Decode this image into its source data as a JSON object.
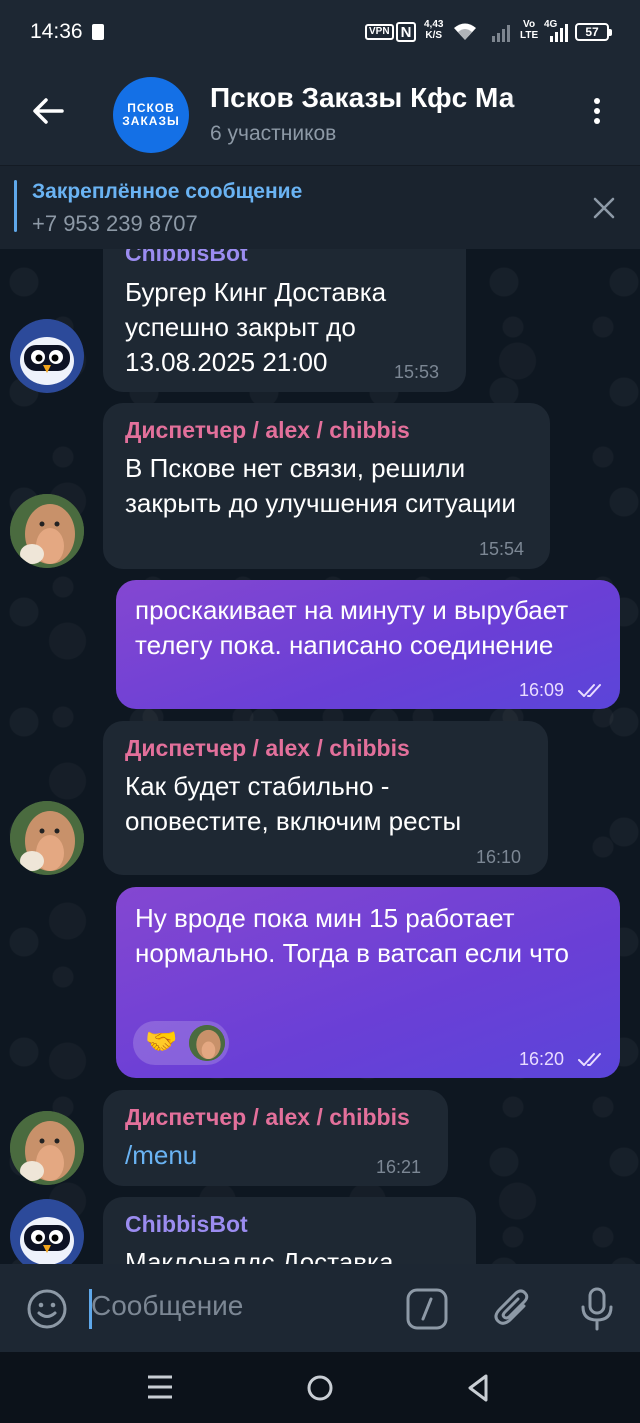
{
  "status": {
    "time": "14:36",
    "vpn": "VPN",
    "nfc": "N",
    "speed_value": "4,43",
    "speed_unit": "K/S",
    "volte_top": "Vo",
    "volte_bottom": "LTE",
    "network": "4G",
    "battery": "57"
  },
  "header": {
    "avatar_line1": "ПСКОВ",
    "avatar_line2": "ЗАКАЗЫ",
    "title": "Псков Заказы Кфс Ма",
    "subtitle": "6 участников"
  },
  "pinned": {
    "label": "Закреплённое сообщение",
    "text": "+7 953 239 8707"
  },
  "messages": [
    {
      "sender": "ChibbisBot",
      "text": "Бургер Кинг Доставка успешно закрыт до 13.08.2025 21:00",
      "time": "15:53"
    },
    {
      "sender": "Диспетчер / alex / chibbis",
      "text": "В Пскове нет связи, решили закрыть до улучшения ситуации",
      "time": "15:54"
    },
    {
      "text": "проскакивает на минуту и вырубает телегу пока. написано соединение",
      "time": "16:09"
    },
    {
      "sender": "Диспетчер / alex / chibbis",
      "text": "Как будет стабильно - оповестите, включим ресты",
      "time": "16:10"
    },
    {
      "text": "Ну вроде пока мин 15 работает нормально. Тогда в ватсап если что",
      "time": "16:20",
      "reaction": "🤝"
    },
    {
      "sender": "Диспетчер / alex / chibbis",
      "text": "/menu",
      "time": "16:21"
    },
    {
      "sender": "ChibbisBot",
      "text": "Макдоналдс Доставка"
    }
  ],
  "input": {
    "placeholder": "Сообщение"
  },
  "colors": {
    "outgoing": "#7a44d4",
    "incoming": "#1e2833",
    "accent": "#6ab3f3",
    "sender": "#e3709b"
  },
  "icons": [
    "back-arrow-icon",
    "more-icon",
    "close-icon",
    "emoji-icon",
    "slash-command-icon",
    "attach-icon",
    "mic-icon",
    "nav-menu-icon",
    "nav-home-icon",
    "nav-back-icon"
  ]
}
